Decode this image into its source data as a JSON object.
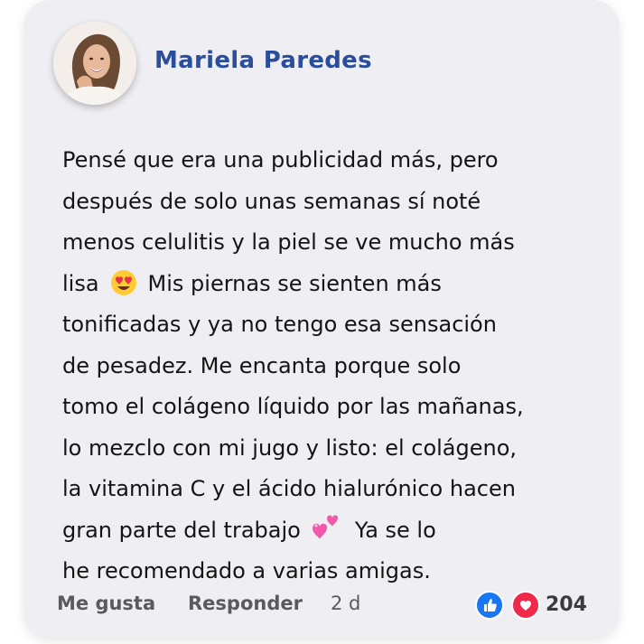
{
  "comment": {
    "author": "Mariela Paredes",
    "lines": [
      "Pensé que era una publicidad más, pero",
      "después de solo unas semanas sí noté",
      "menos celulitis y la piel se ve mucho más",
      "Mis piernas se sienten más",
      "tonificadas y ya no tengo esa sensación",
      "de pesadez. Me encanta porque solo",
      "tomo el colágeno líquido por las mañanas,",
      "lo mezclo con mi jugo y listo: el colágeno,",
      "la vitamina C y el ácido hialurónico hacen",
      "Ya se lo",
      "he recomendado a varias amigas."
    ],
    "line4_prefix": "lisa",
    "line10_prefix": "gran parte del trabajo",
    "emoji_line4": "heart-eyes-emoji",
    "emoji_line10": "two-hearts-emoji"
  },
  "actions": {
    "like_label": "Me gusta",
    "reply_label": "Responder",
    "time": "2 d"
  },
  "reactions": {
    "icons": [
      "like-reaction-icon",
      "love-reaction-icon"
    ],
    "count": "204",
    "colors": {
      "like": "#1877f2",
      "love": "#f0284a"
    }
  },
  "theme": {
    "card_bg": "#efeff3",
    "author_color": "#2a4d9c",
    "text_color": "#141414"
  }
}
